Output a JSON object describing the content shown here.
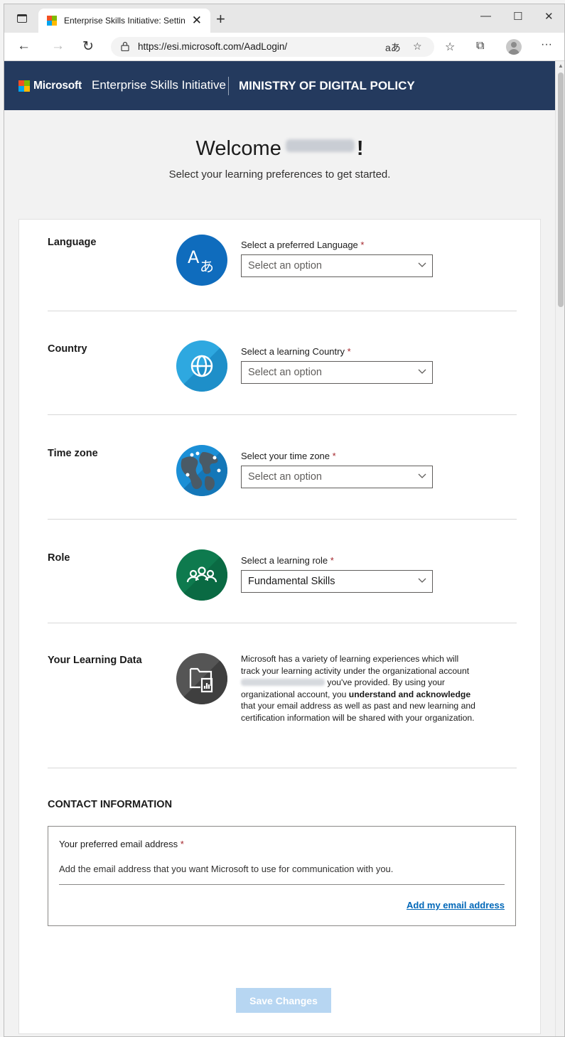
{
  "browser": {
    "tab_title": "Enterprise Skills Initiative: Settings",
    "tab_close": "✕",
    "new_tab": "+",
    "url": "https://esi.microsoft.com/AadLogin/",
    "window_controls": {
      "minimize": "—",
      "maximize": "☐",
      "close": "✕"
    },
    "more_label": "···"
  },
  "header": {
    "microsoft": "Microsoft",
    "program": "Enterprise Skills Initiative",
    "organization": "MINISTRY OF DIGITAL POLICY"
  },
  "welcome": {
    "greeting": "Welcome",
    "exclaim": "!",
    "subtitle": "Select your learning preferences to get started."
  },
  "preferences": [
    {
      "section": "Language",
      "field_label": "Select a preferred Language",
      "value": "Select an option",
      "icon": "language-translate-icon",
      "color": "#0f6cbd"
    },
    {
      "section": "Country",
      "field_label": "Select a learning Country",
      "value": "Select an option",
      "icon": "globe-icon",
      "color": "#2ea8e0"
    },
    {
      "section": "Time zone",
      "field_label": "Select your time zone",
      "value": "Select an option",
      "icon": "world-map-icon",
      "color": "#1b8fd6"
    },
    {
      "section": "Role",
      "field_label": "Select a learning role",
      "value": "Fundamental Skills",
      "icon": "people-group-icon",
      "color": "#0e7a4e"
    }
  ],
  "required_mark": "*",
  "learning_data": {
    "section": "Your Learning Data",
    "text_before": "Microsoft has a variety of learning experiences which will track your learning activity under the organizational account",
    "text_after": "you've provided. By using your organizational account, you",
    "emphasis": "understand and acknowledge",
    "text_end": "that your email address as well as past and new learning and certification information will be shared with your organization."
  },
  "contact": {
    "title": "CONTACT INFORMATION",
    "email_label": "Your preferred email address",
    "description": "Add the email address that you want Microsoft to use for communication with you.",
    "add_link": "Add my email address"
  },
  "save_button": "Save Changes"
}
